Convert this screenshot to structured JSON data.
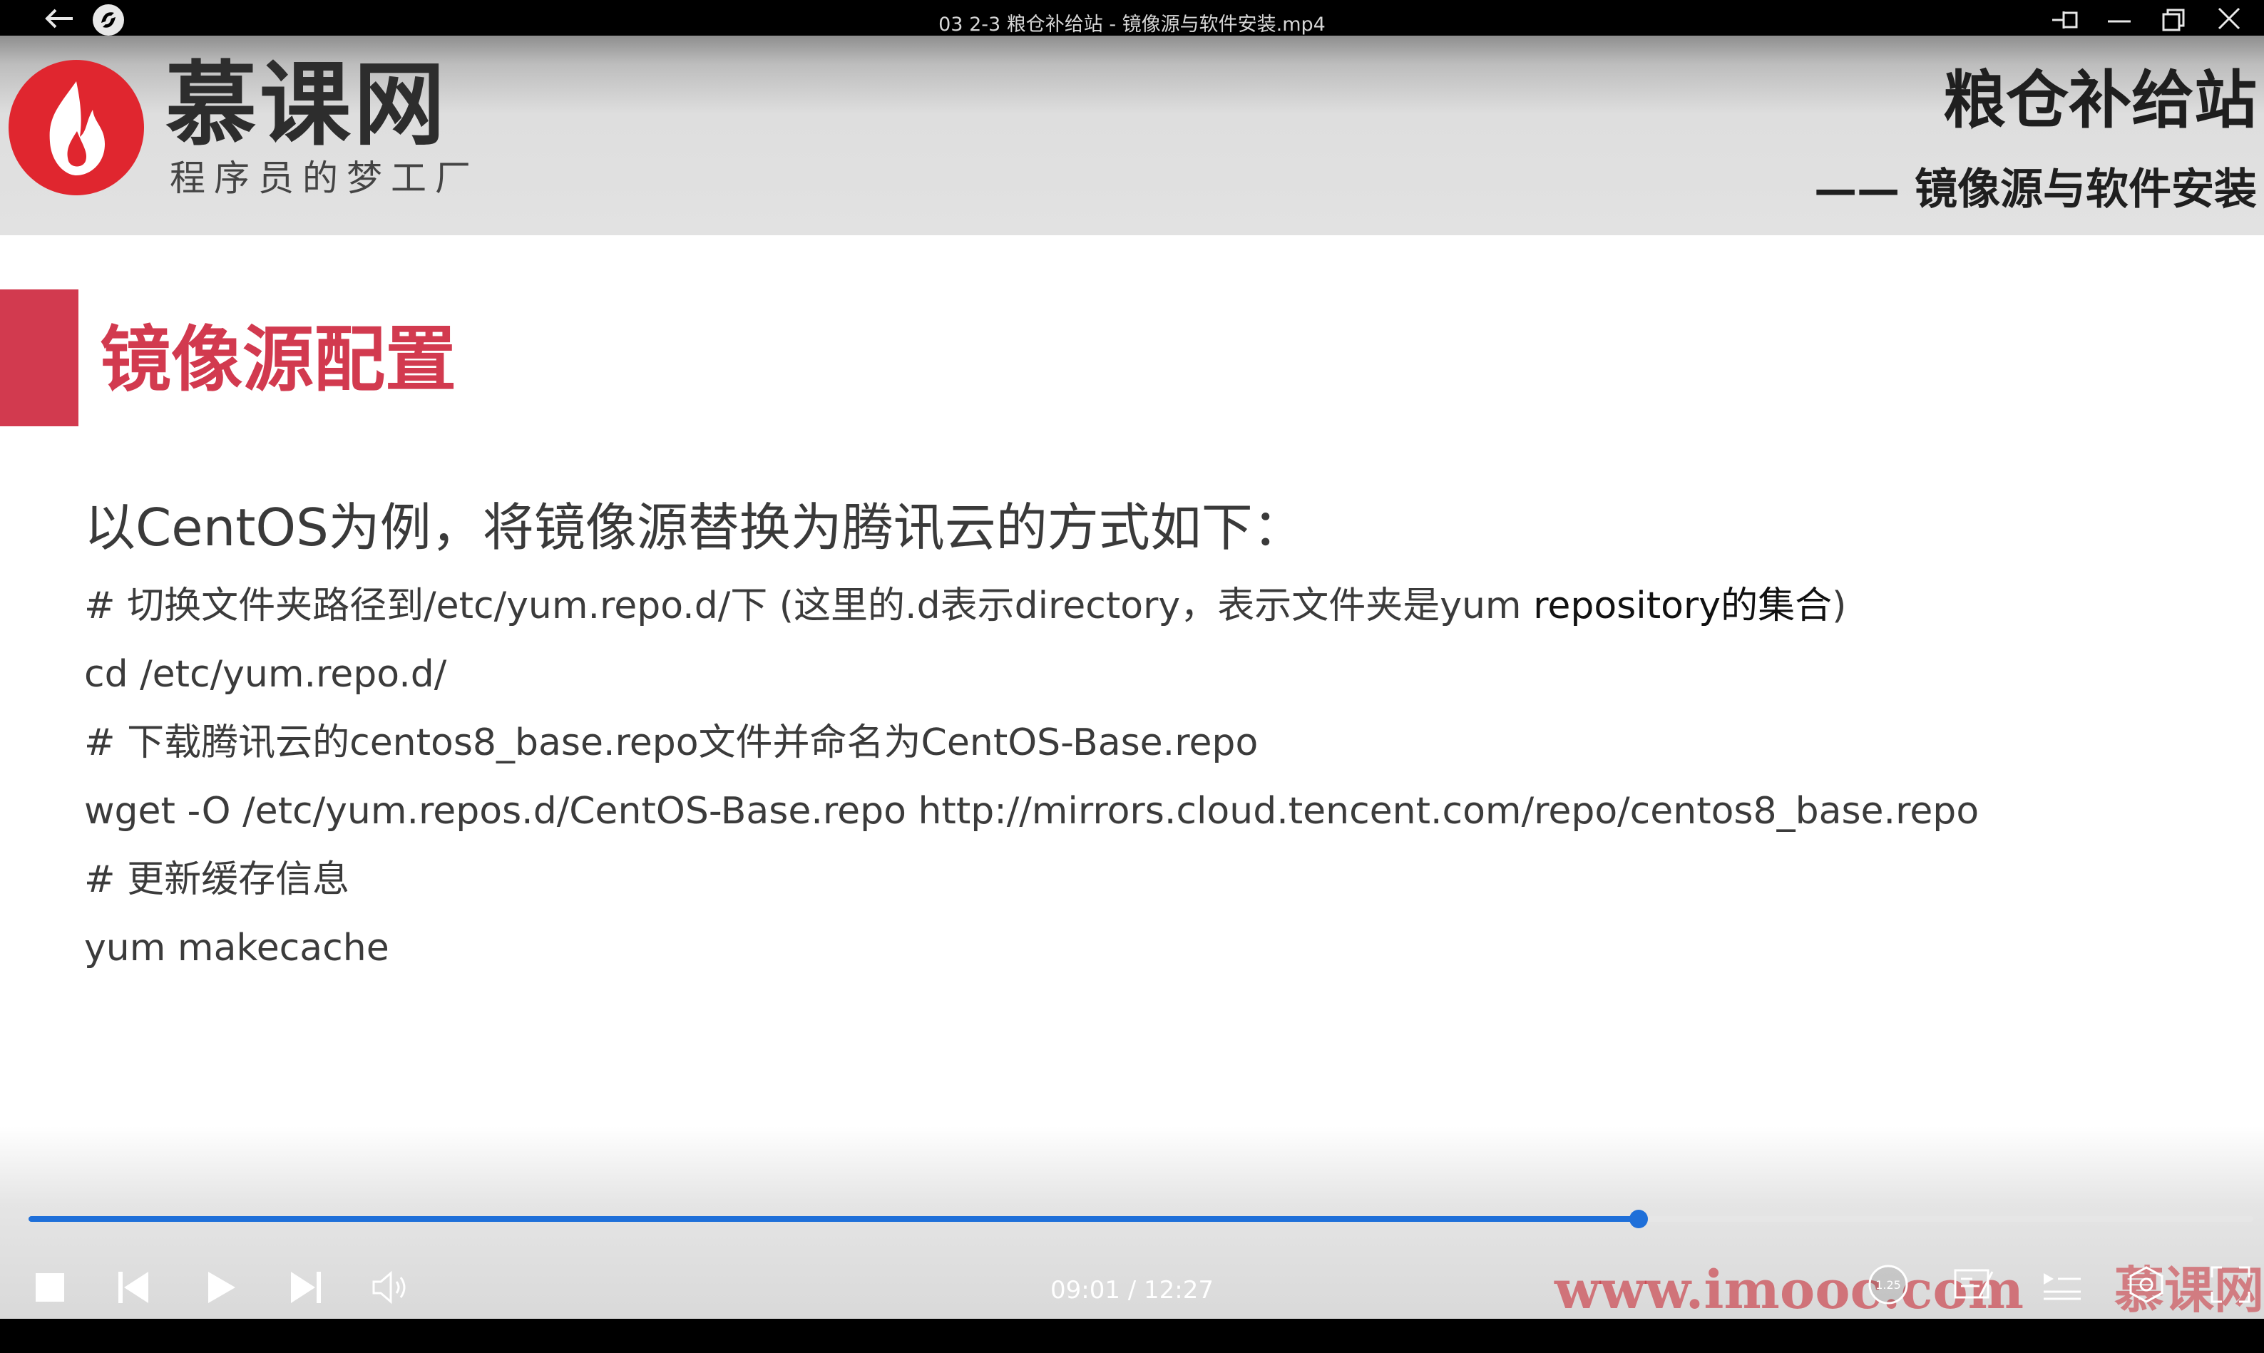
{
  "window": {
    "title": "03 2-3 粮仓补给站 - 镜像源与软件安装.mp4",
    "icons": [
      "back-arrow-icon",
      "app-logo-icon",
      "pin-icon",
      "minimize-icon",
      "restore-icon",
      "close-icon"
    ]
  },
  "slide": {
    "brand_name": "慕课网",
    "brand_slogan": "程序员的梦工厂",
    "course_title": "粮仓补给站",
    "course_subtitle": "—— 镜像源与软件安装",
    "section_title": "镜像源配置",
    "intro": "以CentOS为例，将镜像源替换为腾讯云的方式如下：",
    "code": {
      "line1_a": "# 切换文件夹路径到/etc/yum.repo.d/下 (这里的.d表示directory，表示文件夹是yum ",
      "line1_b": "repository的集合",
      "line1_c": ")",
      "line2": "cd /etc/yum.repo.d/",
      "line3": "# 下载腾讯云的centos8_base.repo文件并命名为CentOS-Base.repo",
      "line4": "wget -O /etc/yum.repos.d/CentOS-Base.repo http://mirrors.cloud.tencent.com/repo/centos8_base.repo",
      "line5": "# 更新缓存信息",
      "line6": "yum makecache"
    },
    "colors": {
      "accent_red": "#d23a4f",
      "header_gray": "#e2e2e2"
    }
  },
  "player": {
    "elapsed": "09:01",
    "separator": " / ",
    "duration": "12:27",
    "progress_fraction": 0.7236,
    "speed_label": "1.25",
    "watermark_url": "www.imooc.com",
    "watermark_brand": "慕课网",
    "progress_color": "#1e6fd9",
    "icons": [
      "stop-icon",
      "previous-icon",
      "play-icon",
      "next-icon",
      "volume-icon",
      "speed-icon",
      "subtitle-icon",
      "playlist-icon",
      "settings-icon",
      "fullscreen-icon"
    ]
  }
}
